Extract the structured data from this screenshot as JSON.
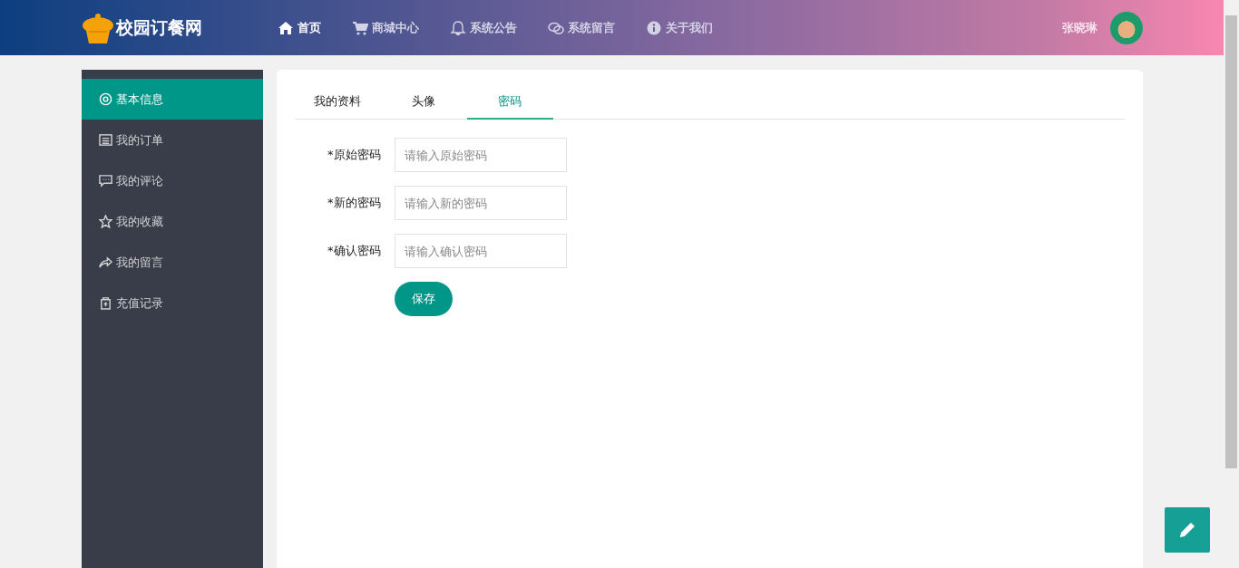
{
  "header": {
    "logo": "校园订餐网",
    "nav": [
      {
        "label": "首页",
        "selected": true
      },
      {
        "label": "商城中心",
        "selected": false
      },
      {
        "label": "系统公告",
        "selected": false
      },
      {
        "label": "系统留言",
        "selected": false
      },
      {
        "label": "关于我们",
        "selected": false
      }
    ],
    "user_name": "张晓琳"
  },
  "sidebar": {
    "items": [
      {
        "label": "基本信息",
        "selected": true
      },
      {
        "label": "我的订单",
        "selected": false
      },
      {
        "label": "我的评论",
        "selected": false
      },
      {
        "label": "我的收藏",
        "selected": false
      },
      {
        "label": "我的留言",
        "selected": false
      },
      {
        "label": "充值记录",
        "selected": false
      }
    ]
  },
  "tabs": [
    {
      "label": "我的资料",
      "selected": false
    },
    {
      "label": "头像",
      "selected": false
    },
    {
      "label": "密码",
      "selected": true
    }
  ],
  "form": {
    "fields": [
      {
        "label": "*原始密码",
        "placeholder": "请输入原始密码"
      },
      {
        "label": "*新的密码",
        "placeholder": "请输入新的密码"
      },
      {
        "label": "*确认密码",
        "placeholder": "请输入确认密码"
      }
    ],
    "submit": "保存"
  }
}
